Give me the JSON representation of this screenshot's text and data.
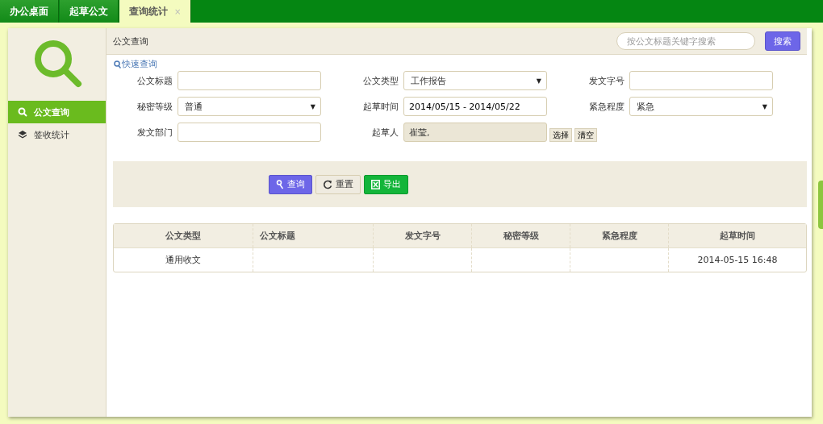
{
  "tabs": [
    {
      "label": "办公桌面",
      "selected": false,
      "closable": false
    },
    {
      "label": "起草公文",
      "selected": false,
      "closable": false
    },
    {
      "label": "查询统计",
      "selected": true,
      "closable": true
    }
  ],
  "close_glyph": "×",
  "sidebar": {
    "items": [
      {
        "label": "公文查询",
        "kind": "search",
        "selected": true
      },
      {
        "label": "签收统计",
        "kind": "layers",
        "selected": false
      }
    ]
  },
  "panel": {
    "title": "公文查询",
    "search": {
      "placeholder": "按公文标题关键字搜索"
    },
    "search_button": "搜索"
  },
  "quick_query": "快速查询",
  "fields": [
    {
      "label": "公文标题",
      "kind": "text"
    },
    {
      "label": "公文类型",
      "kind": "select",
      "value": "工作报告"
    },
    {
      "label": "发文字号",
      "kind": "text"
    },
    {
      "label": "秘密等级",
      "kind": "select",
      "value": "普通"
    },
    {
      "label": "起草时间",
      "kind": "text",
      "value": "2014/05/15 - 2014/05/22"
    },
    {
      "label": "紧急程度",
      "kind": "select",
      "value": "紧急"
    },
    {
      "label": "发文部门",
      "kind": "text"
    },
    {
      "label": "起草人",
      "kind": "picker",
      "value": "崔莹,",
      "buttons": [
        "选择",
        "清空"
      ]
    }
  ],
  "select_caret": "▼",
  "actions": [
    {
      "label": "查询",
      "kind": "query"
    },
    {
      "label": "重置",
      "kind": "reset"
    },
    {
      "label": "导出",
      "kind": "export"
    }
  ],
  "table": {
    "columns": [
      "公文类型",
      "公文标题",
      "发文字号",
      "秘密等级",
      "紧急程度",
      "起草时间"
    ],
    "rows": [
      [
        "通用收文",
        "",
        "",
        "",
        "",
        "2014-05-15 16:48"
      ]
    ]
  }
}
